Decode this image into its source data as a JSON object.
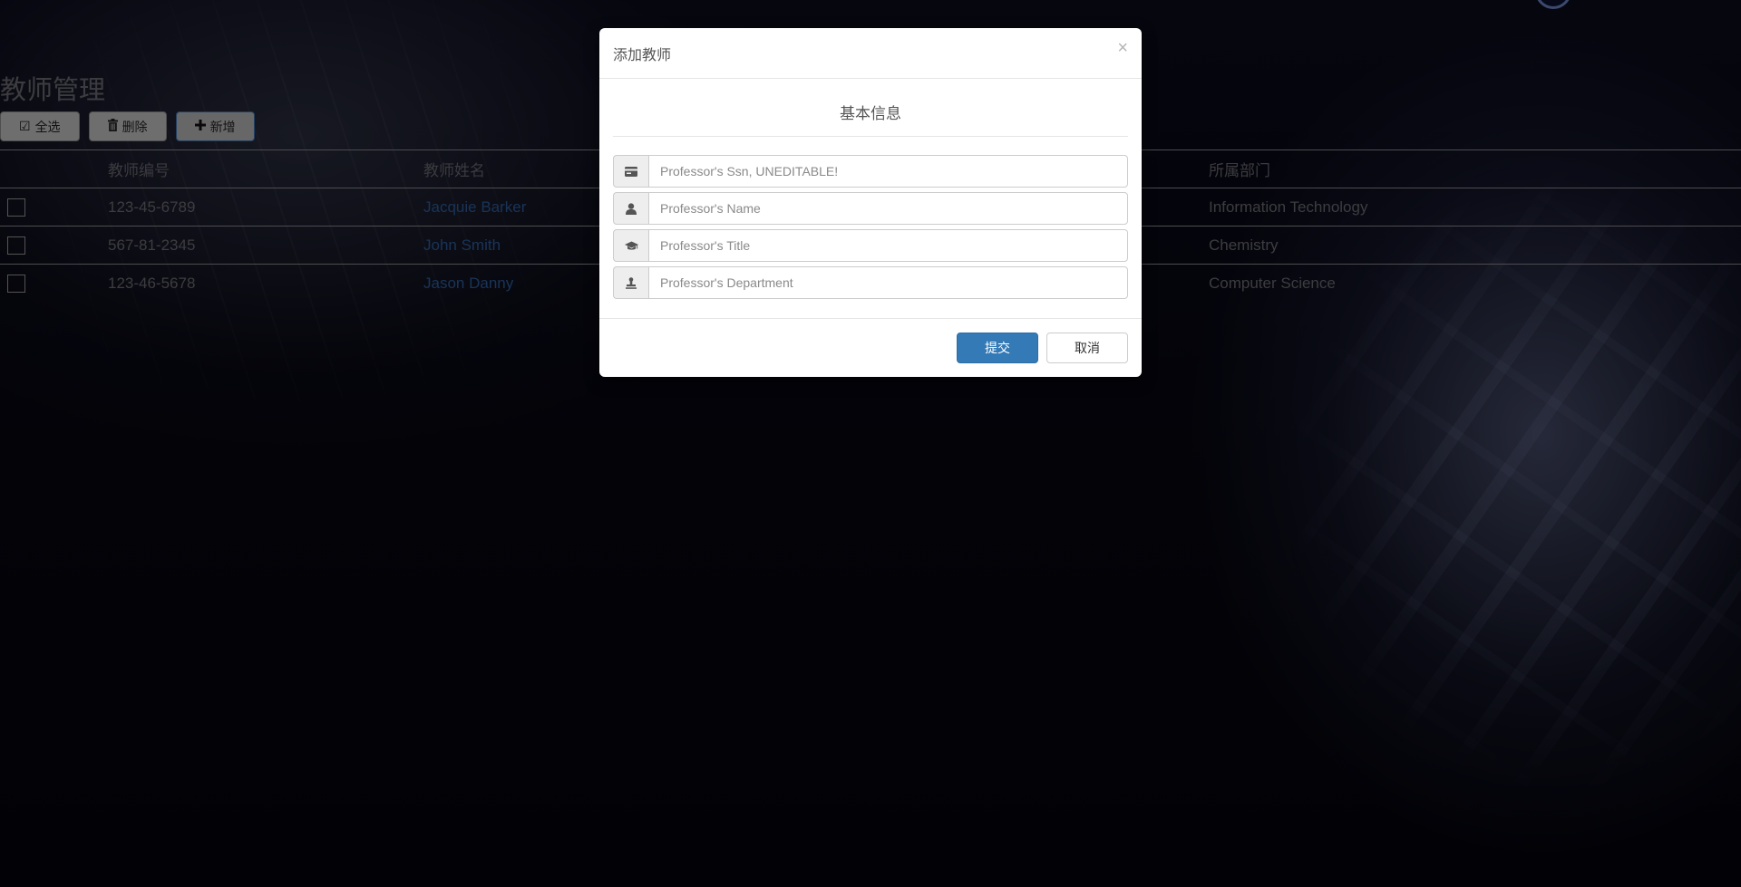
{
  "page": {
    "title": "教师管理",
    "toolbar": {
      "select_all_label": "全选",
      "delete_label": "删除",
      "add_label": "新增",
      "select_all_icon": "check-square-icon",
      "delete_icon": "trash-icon",
      "add_icon": "plus-icon"
    }
  },
  "table": {
    "columns": [
      "教师编号",
      "教师姓名",
      "所属部门"
    ],
    "rows": [
      {
        "ssn": "123-45-6789",
        "name": "Jacquie Barker",
        "department": "Information Technology"
      },
      {
        "ssn": "567-81-2345",
        "name": "John Smith",
        "department": "Chemistry"
      },
      {
        "ssn": "123-46-5678",
        "name": "Jason Danny",
        "department": "Computer Science"
      }
    ]
  },
  "modal": {
    "title": "添加教师",
    "close_symbol": "×",
    "section_title": "基本信息",
    "fields": [
      {
        "icon": "id-card-icon",
        "placeholder": "Professor's Ssn, UNEDITABLE!",
        "value": ""
      },
      {
        "icon": "user-icon",
        "placeholder": "Professor's Name",
        "value": ""
      },
      {
        "icon": "graduation-cap-icon",
        "placeholder": "Professor's Title",
        "value": ""
      },
      {
        "icon": "stamp-icon",
        "placeholder": "Professor's Department",
        "value": ""
      }
    ],
    "submit_label": "提交",
    "cancel_label": "取消"
  },
  "colors": {
    "primary": "#337ab7",
    "link": "#2f5f9f",
    "muted_text": "#6e6e76"
  }
}
